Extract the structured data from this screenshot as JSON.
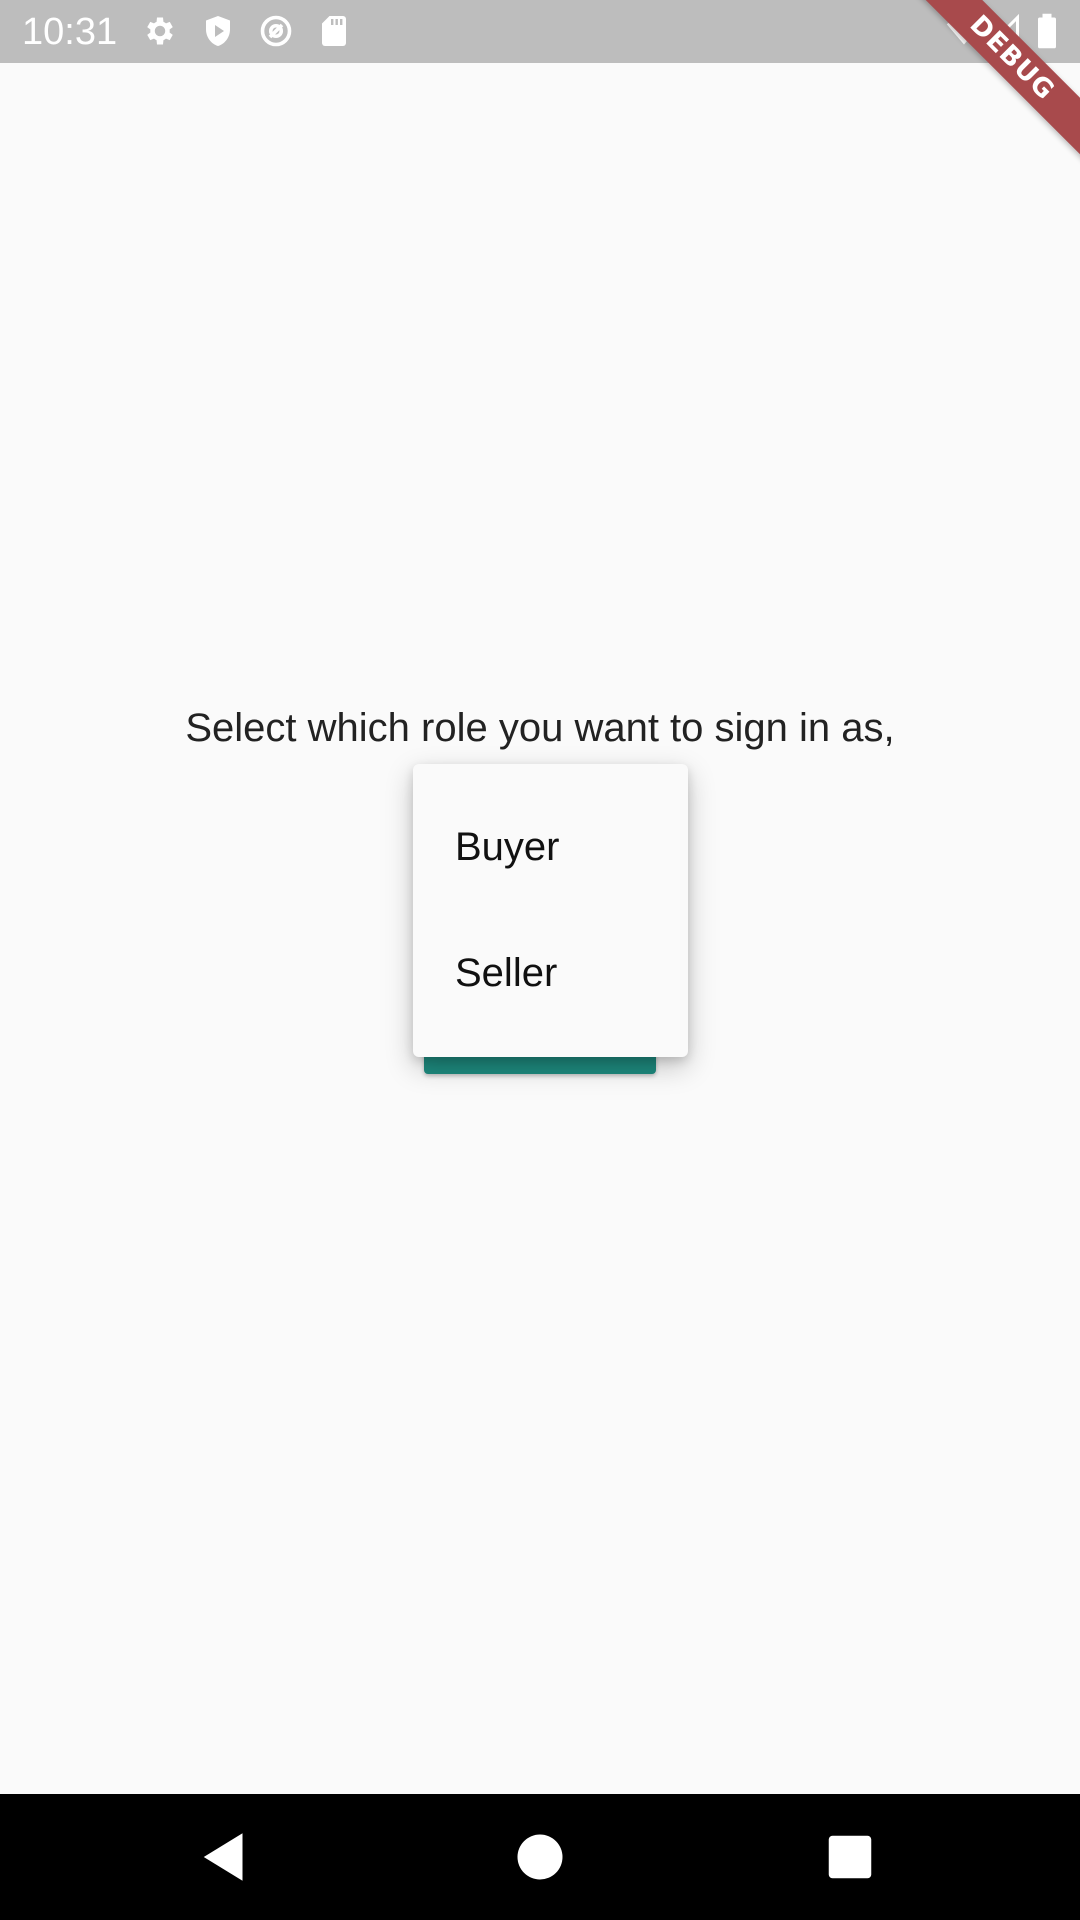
{
  "status_bar": {
    "time": "10:31",
    "left_icons": [
      "gear-icon",
      "shield-play-icon",
      "at-sign-icon",
      "sd-card-icon"
    ],
    "right_icons": [
      "wifi-icon",
      "cell-signal-icon",
      "battery-icon"
    ]
  },
  "debug_banner": {
    "label": "DEBUG",
    "color": "#a84a4c"
  },
  "main": {
    "prompt": "Select which role you want to sign in as,"
  },
  "role_menu": {
    "options": [
      "Buyer",
      "Seller"
    ]
  },
  "button": {
    "color": "#1e8a7e"
  },
  "nav_bar": {
    "buttons": [
      "back-icon",
      "home-icon",
      "recents-icon"
    ]
  }
}
